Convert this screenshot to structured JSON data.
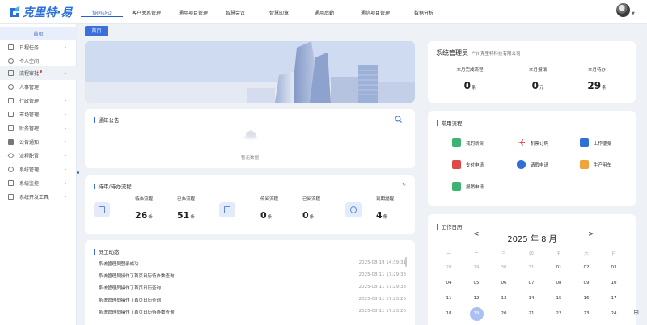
{
  "app": {
    "logo_text": "克里特·易"
  },
  "nav": [
    "协同办公",
    "客户关系管理",
    "通用项目管理",
    "智慧会议",
    "智慧印章",
    "通用后勤",
    "通信项目管理",
    "数据分析"
  ],
  "sidebar": {
    "home": "首页",
    "items": [
      "日程任务",
      "个人空间",
      "流程审批",
      "人事管理",
      "行政管理",
      "市场管理",
      "财务管理",
      "公告通知",
      "流程配置",
      "系统管理",
      "系统监控",
      "系统开发工具"
    ]
  },
  "tab": {
    "label": "首页"
  },
  "notice": {
    "title": "通知公告",
    "empty": "暂无数据"
  },
  "flow": {
    "title": "待审/待办流程",
    "stats": [
      {
        "label": "待办流程",
        "value": "26",
        "unit": "条"
      },
      {
        "label": "已办流程",
        "value": "51",
        "unit": "条"
      },
      {
        "label": "传阅流程",
        "value": "0",
        "unit": "条"
      },
      {
        "label": "已阅流程",
        "value": "0",
        "unit": "条"
      },
      {
        "label": "到期提醒",
        "value": "4",
        "unit": "条"
      }
    ]
  },
  "activity": {
    "title": "员工动态",
    "rows": [
      {
        "text": "系统管理员登录成功",
        "time": "2025-08-19 14:39:31"
      },
      {
        "text": "系统管理员操作了首页日历待办数查询",
        "time": "2025-08-11 17:29:33"
      },
      {
        "text": "系统管理员操作了首页日历查询",
        "time": "2025-08-11 17:29:33"
      },
      {
        "text": "系统管理员操作了首页日历查询",
        "time": "2025-08-11 17:23:20"
      },
      {
        "text": "系统管理员操作了首页日历待办数查询",
        "time": "2025-08-11 17:23:20"
      }
    ]
  },
  "admin": {
    "name": "系统管理员",
    "company": "广州克里特科技有限公司",
    "stats": [
      {
        "label": "本月完成流程",
        "value": "0",
        "unit": "条"
      },
      {
        "label": "本月报销",
        "value": "0",
        "unit": "元"
      },
      {
        "label": "本月待办",
        "value": "29",
        "unit": "条"
      }
    ]
  },
  "common": {
    "title": "常用流程",
    "items": [
      "我的薪资",
      "机票订购",
      "工作便笺",
      "支付申请",
      "请假申请",
      "生产用车",
      "报销申请"
    ]
  },
  "calendar": {
    "title": "工作日历",
    "prev": "<",
    "next": ">",
    "month": "2025 年 8 月",
    "weekdays": [
      "一",
      "二",
      "三",
      "四",
      "五",
      "六",
      "日"
    ],
    "rows": [
      [
        "28",
        "29",
        "30",
        "31",
        "01",
        "02",
        "03"
      ],
      [
        "04",
        "05",
        "06",
        "07",
        "08",
        "09",
        "10"
      ],
      [
        "11",
        "12",
        "13",
        "14",
        "15",
        "16",
        "17"
      ],
      [
        "18",
        "19",
        "20",
        "21",
        "22",
        "23",
        "24"
      ]
    ]
  },
  "colors": {
    "accent": "#3b6fd9",
    "today": "#a9c1f2",
    "badge": "#e54545"
  }
}
